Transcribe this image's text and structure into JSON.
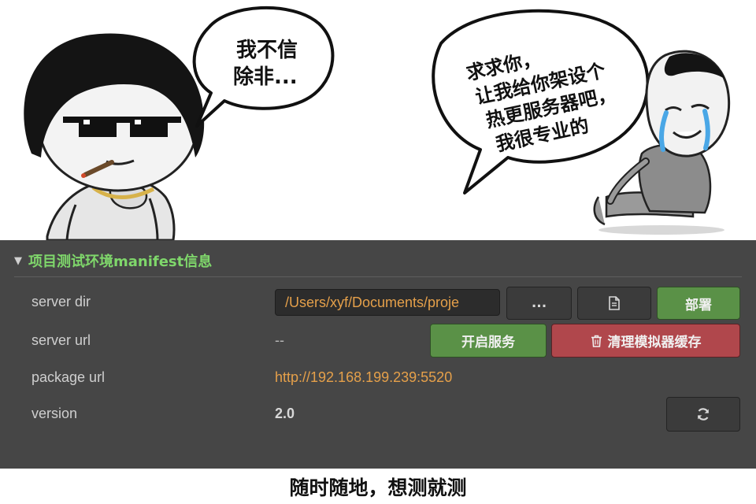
{
  "meme": {
    "left_bubble_lines": [
      "我不信",
      "除非..."
    ],
    "right_bubble_lines": [
      "求求你，",
      "让我给你架设个",
      "热更服务器吧，",
      "我很专业的"
    ]
  },
  "panel": {
    "section_title": "项目测试环境manifest信息",
    "rows": {
      "server_dir": {
        "label": "server dir",
        "value": "/Users/xyf/Documents/proje"
      },
      "server_url": {
        "label": "server url",
        "value": "--"
      },
      "package_url": {
        "label": "package url",
        "value": "http://192.168.199.239:5520"
      },
      "version": {
        "label": "version",
        "value": "2.0"
      }
    },
    "buttons": {
      "browse": "...",
      "deploy": "部署",
      "start_service": "开启服务",
      "clear_cache": "清理模拟器缓存"
    },
    "colors": {
      "accent_green": "#7fd76b",
      "link_orange": "#e5a04a",
      "deploy_green": "#5a9147",
      "danger_red": "#b0474c"
    }
  },
  "caption": "随时随地，想测就测"
}
